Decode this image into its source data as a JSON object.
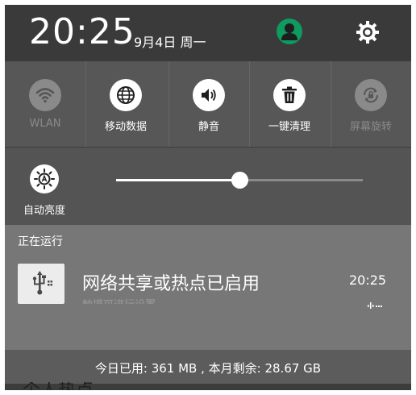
{
  "header": {
    "time": "20:25",
    "date": "9月4日 周一"
  },
  "toggles": [
    {
      "label": "WLAN",
      "icon": "wifi-icon",
      "state": "off"
    },
    {
      "label": "移动数据",
      "icon": "globe-icon",
      "state": "on"
    },
    {
      "label": "静音",
      "icon": "speaker-icon",
      "state": "on"
    },
    {
      "label": "一键清理",
      "icon": "trash-icon",
      "state": "on"
    },
    {
      "label": "屏幕旋转",
      "icon": "rotation-lock-icon",
      "state": "off"
    }
  ],
  "brightness": {
    "auto_label": "自动亮度",
    "level": 0.5
  },
  "running": {
    "title": "正在运行",
    "notification": {
      "icon": "usb-tethering-icon",
      "title": "网络共享或热点已启用",
      "subtitle": "触摸可进行设置",
      "time": "20:25"
    }
  },
  "usage": {
    "text": "今日已用: 361 MB , 本月剩余: 28.67 GB"
  },
  "background": {
    "peek_text": "个人热点"
  },
  "colors": {
    "avatar": "#0f9a60",
    "shade": "#3c3c3c"
  }
}
